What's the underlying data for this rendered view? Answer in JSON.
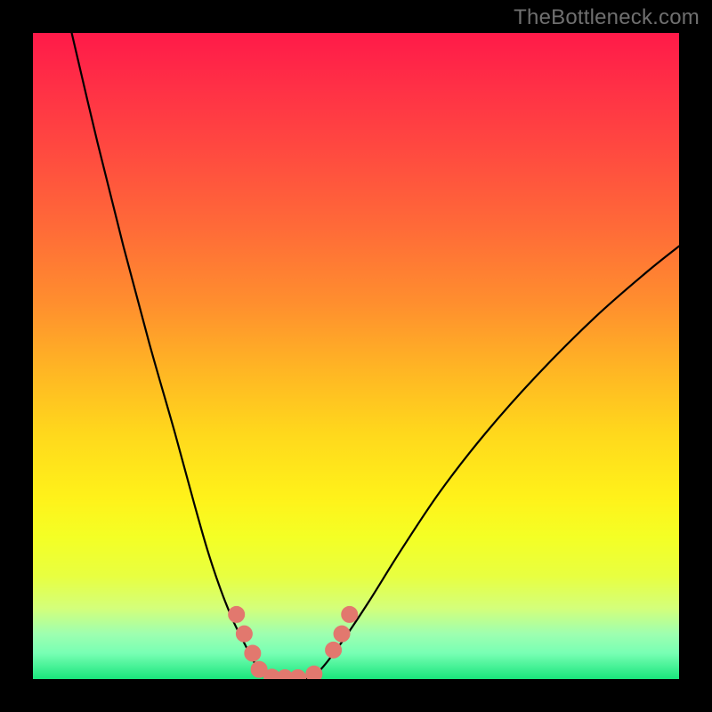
{
  "watermark": "TheBottleneck.com",
  "colors": {
    "background_frame": "#000000",
    "gradient_top": "#ff1a49",
    "gradient_bottom": "#19e57b",
    "marker": "#e2786e",
    "curve": "#000000",
    "watermark_text": "#6f6f6f"
  },
  "chart_data": {
    "type": "line",
    "title": "",
    "xlabel": "",
    "ylabel": "",
    "xlim": [
      0,
      100
    ],
    "ylim": [
      0,
      100
    ],
    "note": "Axes are unlabeled; x and y read as 0–100% of plot area. y=100 at top, y=0 at bottom. Two black curves form a V meeting near the bottom.",
    "series": [
      {
        "name": "left_curve",
        "x": [
          6,
          10,
          14,
          18,
          22,
          25,
          27,
          29,
          31,
          33,
          34,
          35,
          36,
          37
        ],
        "y": [
          100,
          83,
          67,
          52,
          38,
          27,
          20,
          14,
          9,
          5,
          3,
          1.5,
          0.5,
          0
        ]
      },
      {
        "name": "valley_floor",
        "x": [
          37,
          39,
          41,
          43
        ],
        "y": [
          0,
          0,
          0,
          0
        ]
      },
      {
        "name": "right_curve",
        "x": [
          43,
          45,
          48,
          52,
          57,
          63,
          70,
          78,
          87,
          95,
          100
        ],
        "y": [
          0,
          2,
          6,
          12,
          20,
          29,
          38,
          47,
          56,
          63,
          67
        ]
      }
    ],
    "markers": {
      "name": "highlight_points_salmon",
      "points": [
        {
          "x": 31.5,
          "y": 10
        },
        {
          "x": 32.7,
          "y": 7
        },
        {
          "x": 34.0,
          "y": 4
        },
        {
          "x": 35.0,
          "y": 1.5
        },
        {
          "x": 37.0,
          "y": 0.3
        },
        {
          "x": 39.0,
          "y": 0.2
        },
        {
          "x": 41.0,
          "y": 0.2
        },
        {
          "x": 43.5,
          "y": 0.8
        },
        {
          "x": 46.5,
          "y": 4.5
        },
        {
          "x": 47.8,
          "y": 7
        },
        {
          "x": 49.0,
          "y": 10
        }
      ]
    }
  }
}
